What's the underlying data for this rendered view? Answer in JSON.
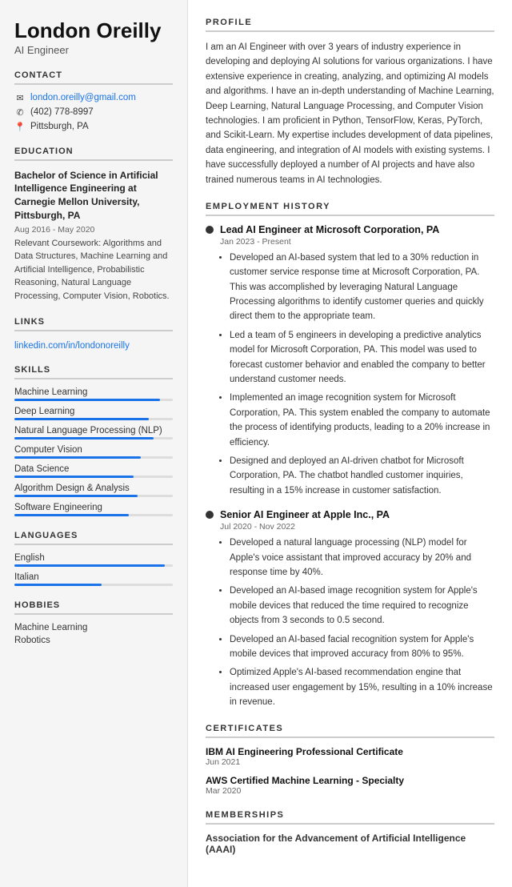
{
  "sidebar": {
    "name": "London Oreilly",
    "title": "AI Engineer",
    "contact": {
      "email": "london.oreilly@gmail.com",
      "phone": "(402) 778-8997",
      "location": "Pittsburgh, PA"
    },
    "education": {
      "degree": "Bachelor of Science in Artificial Intelligence Engineering at Carnegie Mellon University, Pittsburgh, PA",
      "dates": "Aug 2016 - May 2020",
      "courses": "Relevant Coursework: Algorithms and Data Structures, Machine Learning and Artificial Intelligence, Probabilistic Reasoning, Natural Language Processing, Computer Vision, Robotics."
    },
    "links": [
      {
        "label": "linkedin.com/in/londonoreilly",
        "url": "https://linkedin.com/in/londonoreilly"
      }
    ],
    "skills": [
      {
        "label": "Machine Learning",
        "pct": 92
      },
      {
        "label": "Deep Learning",
        "pct": 85
      },
      {
        "label": "Natural Language Processing (NLP)",
        "pct": 88
      },
      {
        "label": "Computer Vision",
        "pct": 80
      },
      {
        "label": "Data Science",
        "pct": 75
      },
      {
        "label": "Algorithm Design & Analysis",
        "pct": 78
      },
      {
        "label": "Software Engineering",
        "pct": 72
      }
    ],
    "languages": [
      {
        "label": "English",
        "pct": 95
      },
      {
        "label": "Italian",
        "pct": 55
      }
    ],
    "hobbies": [
      "Machine Learning",
      "Robotics"
    ]
  },
  "main": {
    "sections": {
      "profile_title": "PROFILE",
      "profile_text": "I am an AI Engineer with over 3 years of industry experience in developing and deploying AI solutions for various organizations. I have extensive experience in creating, analyzing, and optimizing AI models and algorithms. I have an in-depth understanding of Machine Learning, Deep Learning, Natural Language Processing, and Computer Vision technologies. I am proficient in Python, TensorFlow, Keras, PyTorch, and Scikit-Learn. My expertise includes development of data pipelines, data engineering, and integration of AI models with existing systems. I have successfully deployed a number of AI projects and have also trained numerous teams in AI technologies.",
      "employment_title": "EMPLOYMENT HISTORY",
      "jobs": [
        {
          "title": "Lead AI Engineer at Microsoft Corporation, PA",
          "dates": "Jan 2023 - Present",
          "bullets": [
            "Developed an AI-based system that led to a 30% reduction in customer service response time at Microsoft Corporation, PA. This was accomplished by leveraging Natural Language Processing algorithms to identify customer queries and quickly direct them to the appropriate team.",
            "Led a team of 5 engineers in developing a predictive analytics model for Microsoft Corporation, PA. This model was used to forecast customer behavior and enabled the company to better understand customer needs.",
            "Implemented an image recognition system for Microsoft Corporation, PA. This system enabled the company to automate the process of identifying products, leading to a 20% increase in efficiency.",
            "Designed and deployed an AI-driven chatbot for Microsoft Corporation, PA. The chatbot handled customer inquiries, resulting in a 15% increase in customer satisfaction."
          ]
        },
        {
          "title": "Senior AI Engineer at Apple Inc., PA",
          "dates": "Jul 2020 - Nov 2022",
          "bullets": [
            "Developed a natural language processing (NLP) model for Apple's voice assistant that improved accuracy by 20% and response time by 40%.",
            "Developed an AI-based image recognition system for Apple's mobile devices that reduced the time required to recognize objects from 3 seconds to 0.5 second.",
            "Developed an AI-based facial recognition system for Apple's mobile devices that improved accuracy from 80% to 95%.",
            "Optimized Apple's AI-based recommendation engine that increased user engagement by 15%, resulting in a 10% increase in revenue."
          ]
        }
      ],
      "certificates_title": "CERTIFICATES",
      "certificates": [
        {
          "name": "IBM AI Engineering Professional Certificate",
          "date": "Jun 2021"
        },
        {
          "name": "AWS Certified Machine Learning - Specialty",
          "date": "Mar 2020"
        }
      ],
      "memberships_title": "MEMBERSHIPS",
      "memberships": [
        {
          "name": "Association for the Advancement of Artificial Intelligence (AAAI)"
        }
      ]
    }
  }
}
